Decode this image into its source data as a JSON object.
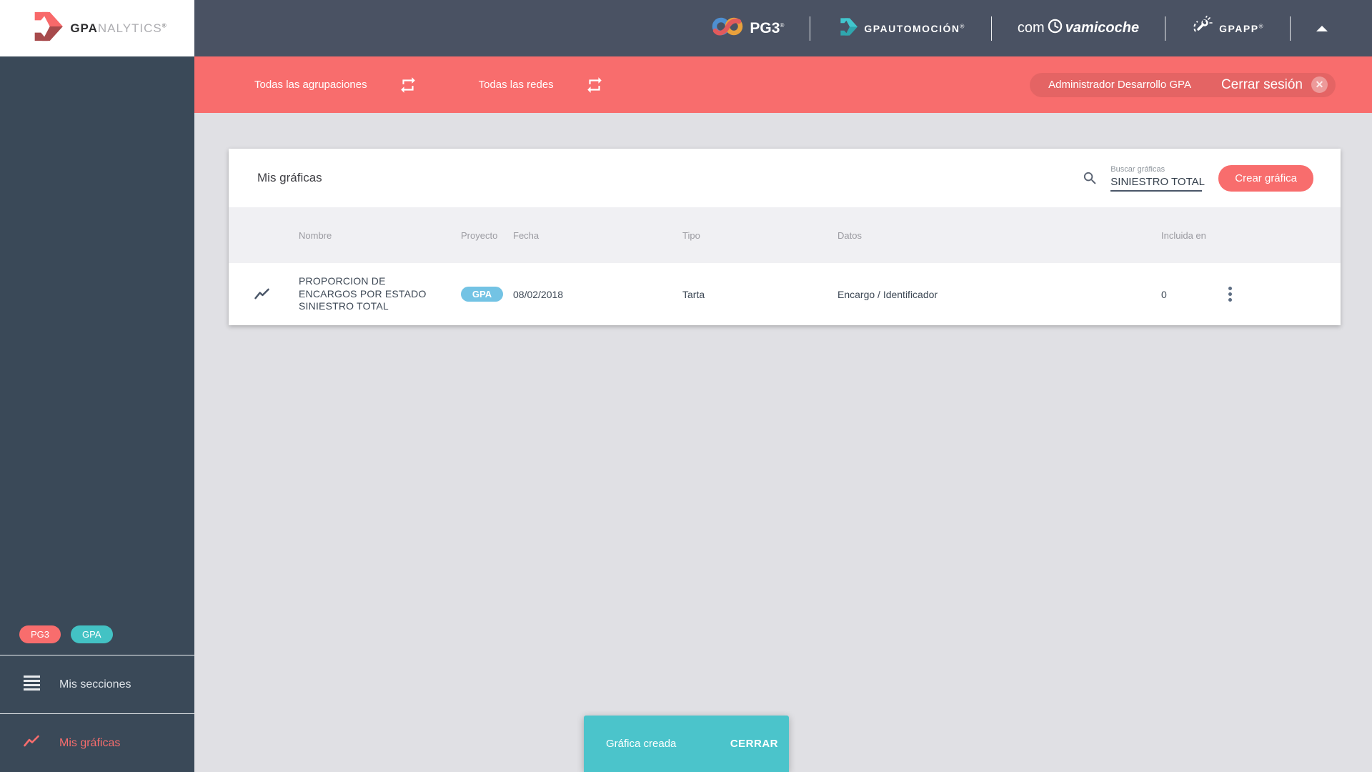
{
  "brand": {
    "gpa": "GPA",
    "nalytics": "NALYTICS",
    "registered": "®"
  },
  "topbar": {
    "pg3_label": "PG3",
    "gpautomocion_label": "GPAUTOMOCIÓN",
    "comvamicoche_prefix": "com",
    "comvamicoche_suffix": "vamicoche",
    "gpapp_label": "GPAPP",
    "registered": "®"
  },
  "filterbar": {
    "groupings_label": "Todas las agrupaciones",
    "networks_label": "Todas las redes",
    "user_label": "Administrador Desarrollo GPA",
    "logout_label": "Cerrar sesión",
    "close_glyph": "✕"
  },
  "sidebar": {
    "badges": [
      {
        "label": "PG3",
        "color": "#f86d6d"
      },
      {
        "label": "GPA",
        "color": "#43c2c4"
      }
    ],
    "items": [
      {
        "label": "Mis secciones"
      },
      {
        "label": "Mis gráficas"
      }
    ]
  },
  "main": {
    "card": {
      "title": "Mis gráficas",
      "search": {
        "label": "Buscar gráficas",
        "value": "SINIESTRO TOTAL"
      },
      "create_button": "Crear gráfica",
      "table": {
        "headers": [
          "Nombre",
          "Proyecto",
          "Fecha",
          "Tipo",
          "Datos",
          "Incluida en"
        ],
        "rows": [
          {
            "name": "PROPORCION DE ENCARGOS POR ESTADO SINIESTRO TOTAL",
            "project": "GPA",
            "date": "08/02/2018",
            "type": "Tarta",
            "data": "Encargo / Identificador",
            "included_in": "0"
          }
        ]
      }
    },
    "snackbar": {
      "message": "Gráfica creada",
      "action": "CERRAR"
    }
  },
  "colors": {
    "accent_red": "#f86d6d",
    "teal": "#43c2c4",
    "snackbar_teal": "#4bc4cb",
    "project_badge_blue": "#73c3e4",
    "topbar_dark": "#4a5263",
    "sidebar_dark": "#3a4958"
  }
}
